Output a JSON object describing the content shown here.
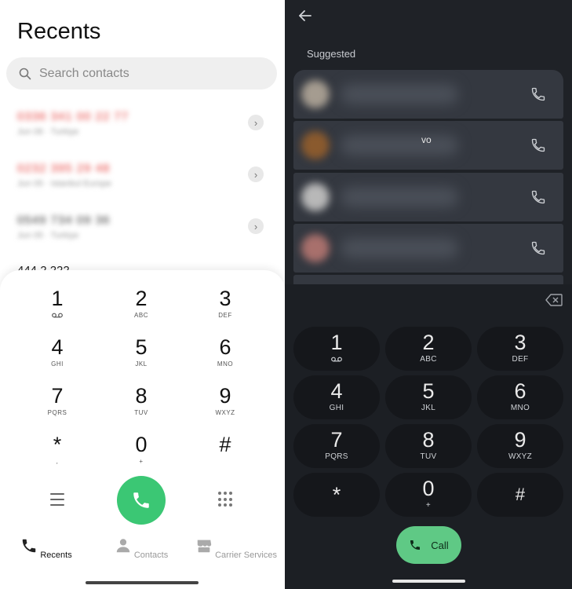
{
  "left": {
    "title": "Recents",
    "search_placeholder": "Search contacts",
    "recents": [
      {
        "number": "0336 341 00 22 77",
        "detail": "Jun 06 · Turkiye"
      },
      {
        "number": "0232 395 29 48",
        "detail": "Jun 05 · Istanbul Europe"
      },
      {
        "number": "0549 734 09 36",
        "detail": "Jun 05 · Turkiye"
      }
    ],
    "partial_number": "444 2 222",
    "keypad": [
      {
        "digit": "1",
        "letters": ""
      },
      {
        "digit": "2",
        "letters": "ABC"
      },
      {
        "digit": "3",
        "letters": "DEF"
      },
      {
        "digit": "4",
        "letters": "GHI"
      },
      {
        "digit": "5",
        "letters": "JKL"
      },
      {
        "digit": "6",
        "letters": "MNO"
      },
      {
        "digit": "7",
        "letters": "PQRS"
      },
      {
        "digit": "8",
        "letters": "TUV"
      },
      {
        "digit": "9",
        "letters": "WXYZ"
      },
      {
        "digit": "*",
        "letters": ","
      },
      {
        "digit": "0",
        "letters": "+"
      },
      {
        "digit": "#",
        "letters": ""
      }
    ],
    "nav": [
      {
        "label": "Recents"
      },
      {
        "label": "Contacts"
      },
      {
        "label": "Carrier Services"
      }
    ],
    "colors": {
      "call": "#3bc774",
      "number_red": "#e53935"
    }
  },
  "right": {
    "suggested_label": "Suggested",
    "visible_fragment": "vo",
    "keypad": [
      {
        "digit": "1",
        "letters": ""
      },
      {
        "digit": "2",
        "letters": "ABC"
      },
      {
        "digit": "3",
        "letters": "DEF"
      },
      {
        "digit": "4",
        "letters": "GHI"
      },
      {
        "digit": "5",
        "letters": "JKL"
      },
      {
        "digit": "6",
        "letters": "MNO"
      },
      {
        "digit": "7",
        "letters": "PQRS"
      },
      {
        "digit": "8",
        "letters": "TUV"
      },
      {
        "digit": "9",
        "letters": "WXYZ"
      },
      {
        "digit": "*",
        "letters": ""
      },
      {
        "digit": "0",
        "letters": "+"
      },
      {
        "digit": "#",
        "letters": ""
      }
    ],
    "call_label": "Call",
    "colors": {
      "call": "#5fc985",
      "background": "#1f2227"
    }
  }
}
